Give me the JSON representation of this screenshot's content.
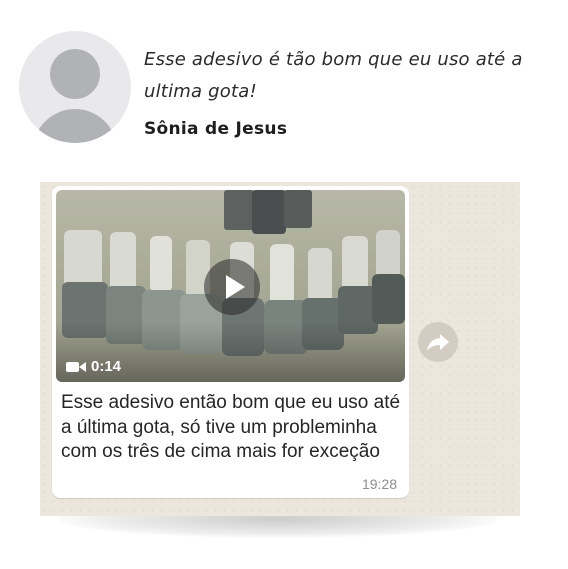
{
  "testimonial": {
    "quote": "Esse adesivo  é tão bom que eu uso até a ultima gota!",
    "author": "Sônia de Jesus",
    "avatar_icon": "default-avatar-icon"
  },
  "chat": {
    "video": {
      "duration": "0:14",
      "play_icon": "play-icon",
      "camera_icon": "video-camera-icon"
    },
    "message_text": "Esse adesivo então bom que eu uso até a última gota, só tive um probleminha com os três de cima mais for exceção",
    "timestamp": "19:28",
    "forward_icon": "forward-icon",
    "colors": {
      "chat_background": "#ece6dc",
      "bubble": "#ffffff",
      "timestamp": "#8e8e8e"
    }
  }
}
